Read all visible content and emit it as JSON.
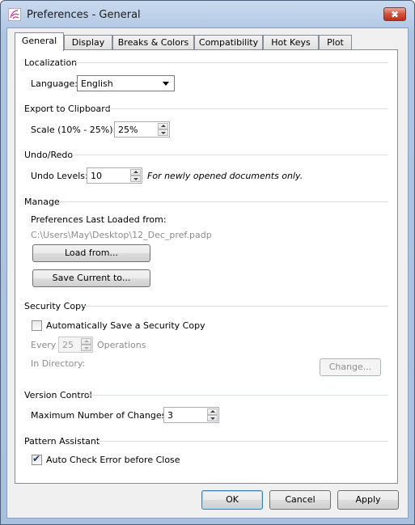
{
  "window": {
    "title": "Preferences - General",
    "close_glyph": "✖",
    "icon": "app-flower-icon"
  },
  "tabs": [
    {
      "label": "General",
      "active": true
    },
    {
      "label": "Display"
    },
    {
      "label": "Breaks & Colors"
    },
    {
      "label": "Compatibility"
    },
    {
      "label": "Hot Keys"
    },
    {
      "label": "Plot"
    }
  ],
  "localization": {
    "heading": "Localization",
    "language_label": "Language:",
    "language_value": "English"
  },
  "export": {
    "heading": "Export to Clipboard",
    "scale_label": "Scale (10% - 25%):",
    "scale_value": "25%"
  },
  "undo": {
    "heading": "Undo/Redo",
    "levels_label": "Undo Levels:",
    "levels_value": "10",
    "note": "For newly opened documents only."
  },
  "manage": {
    "heading": "Manage",
    "loaded_label": "Preferences Last Loaded from:",
    "loaded_path": "C:\\Users\\May\\Desktop\\12_Dec_pref.padp",
    "load_button": "Load from...",
    "save_button": "Save Current to..."
  },
  "security": {
    "heading": "Security Copy",
    "auto_save_label": "Automatically Save a Security Copy",
    "auto_save_checked": false,
    "every_label": "Every",
    "every_value": "25",
    "operations_label": "Operations",
    "directory_label": "In Directory:",
    "change_button": "Change..."
  },
  "version": {
    "heading": "Version Control",
    "max_label": "Maximum Number of Changesets",
    "max_value": "3"
  },
  "pattern": {
    "heading": "Pattern Assistant",
    "auto_check_label": "Auto Check Error before Close",
    "auto_check_checked": true,
    "check_glyph": "✔"
  },
  "footer": {
    "ok": "OK",
    "cancel": "Cancel",
    "apply": "Apply"
  },
  "colors": {
    "title_close": "#c8442c",
    "default_button_border": "#3c7fb1",
    "section_line": "#d5dfe5"
  }
}
